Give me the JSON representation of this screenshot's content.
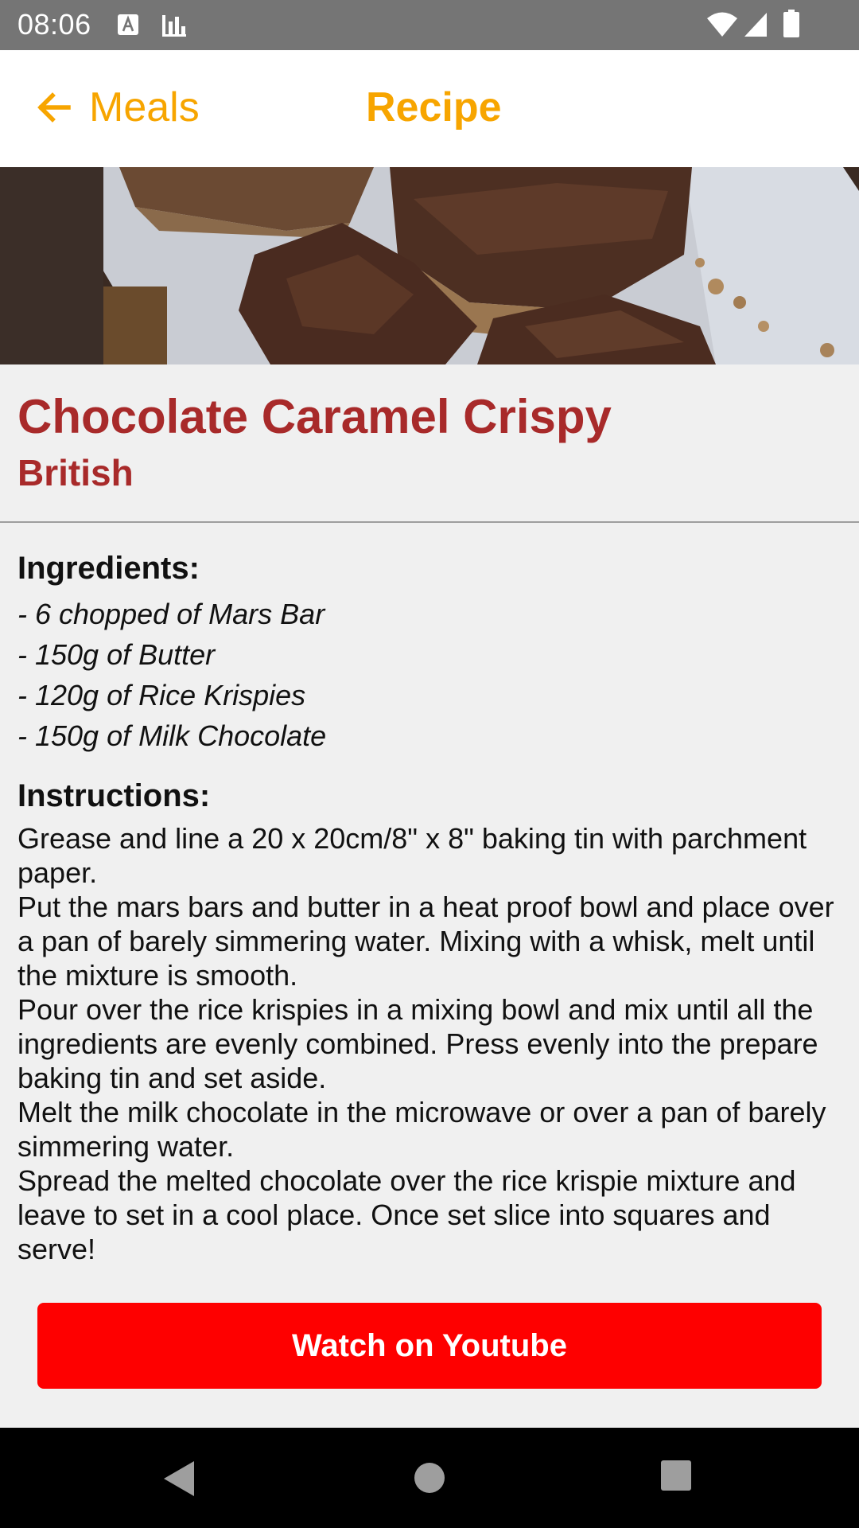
{
  "status_bar": {
    "time": "08:06",
    "icons": [
      "text-notification-icon",
      "stats-notification-icon",
      "wifi-icon",
      "cell-signal-icon",
      "battery-icon"
    ]
  },
  "app_bar": {
    "back_label": "Meals",
    "title": "Recipe",
    "accent_color": "#f7a500"
  },
  "hero": {
    "icon": "recipe-photo"
  },
  "recipe": {
    "title": "Chocolate Caramel Crispy",
    "area": "British",
    "title_color": "#a82a2a"
  },
  "ingredients": {
    "heading": "Ingredients:",
    "items": [
      "- 6 chopped of Mars Bar",
      "- 150g of Butter",
      "- 120g of Rice Krispies",
      "- 150g of Milk Chocolate"
    ]
  },
  "instructions": {
    "heading": "Instructions:",
    "text": "Grease and line a 20 x 20cm/8\" x 8\" baking tin with parchment paper.\nPut the mars bars and butter in a heat proof bowl and place over a pan of barely simmering water. Mixing with a whisk, melt until the mixture is smooth.\nPour over the rice krispies in a mixing bowl and mix until all the ingredients are evenly combined. Press evenly into the prepare baking tin and set aside.\nMelt the milk chocolate in the microwave or over a pan of barely simmering water.\nSpread the melted chocolate over the rice krispie mixture and leave to set in a cool place. Once set slice into squares and serve!"
  },
  "youtube_button": {
    "label": "Watch on Youtube",
    "color": "#fe0000"
  },
  "nav_bar": {
    "icons": [
      "nav-back-icon",
      "nav-home-icon",
      "nav-recents-icon"
    ]
  }
}
